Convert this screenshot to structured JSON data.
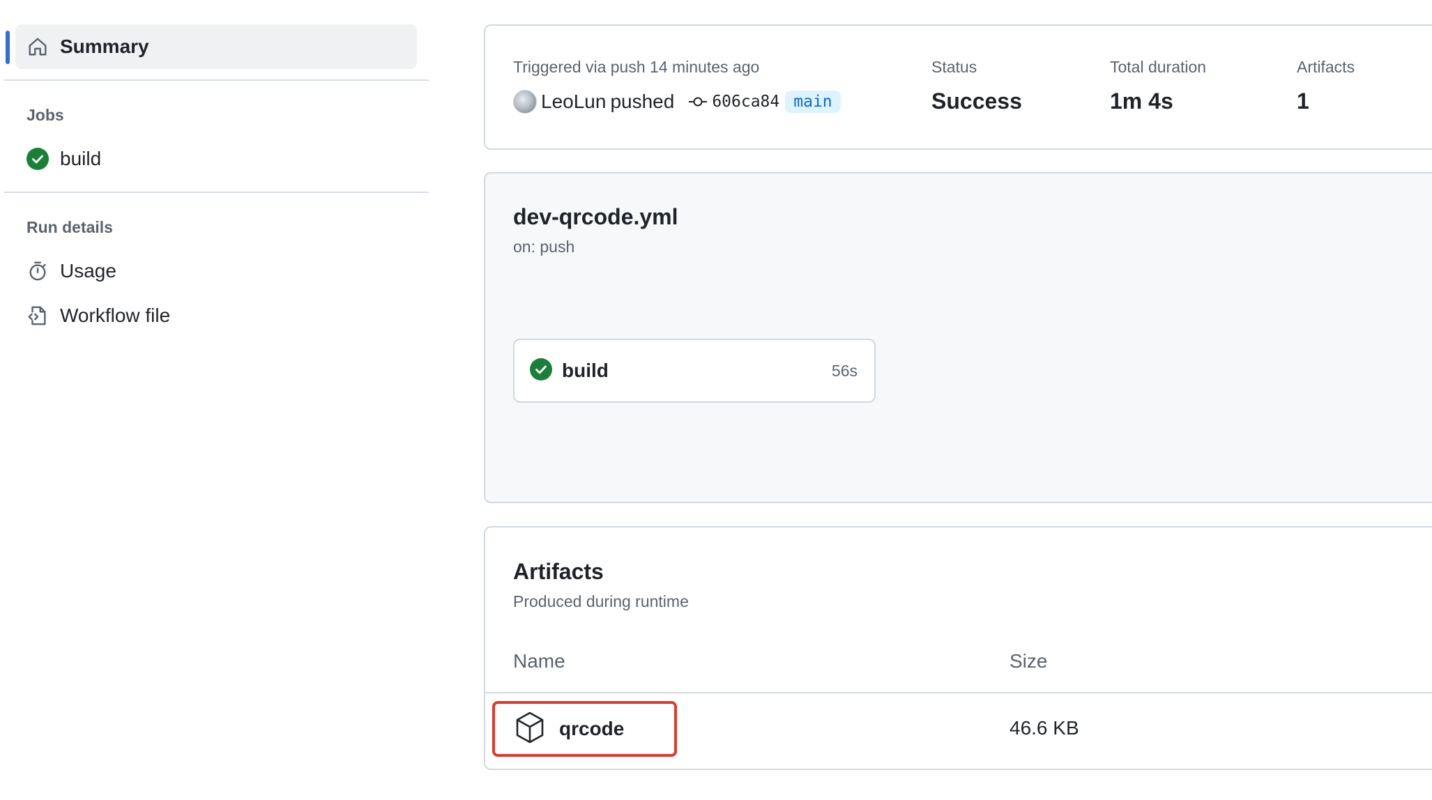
{
  "sidebar": {
    "summary_label": "Summary",
    "jobs_heading": "Jobs",
    "jobs": [
      {
        "label": "build",
        "status": "success"
      }
    ],
    "run_details_heading": "Run details",
    "details": [
      {
        "label": "Usage",
        "icon": "stopwatch-icon"
      },
      {
        "label": "Workflow file",
        "icon": "file-code-icon"
      }
    ]
  },
  "run_header": {
    "trigger_text": "Triggered via push 14 minutes ago",
    "actor": "LeoLun",
    "action": "pushed",
    "commit_sha": "606ca84",
    "branch": "main",
    "status_label": "Status",
    "status_value": "Success",
    "duration_label": "Total duration",
    "duration_value": "1m 4s",
    "artifacts_label": "Artifacts",
    "artifacts_value": "1"
  },
  "workflow": {
    "file_name": "dev-qrcode.yml",
    "trigger": "on: push",
    "jobs": [
      {
        "name": "build",
        "duration": "56s",
        "status": "success"
      }
    ]
  },
  "artifacts": {
    "title": "Artifacts",
    "subtitle": "Produced during runtime",
    "columns": {
      "name": "Name",
      "size": "Size"
    },
    "rows": [
      {
        "name": "qrcode",
        "size": "46.6 KB"
      }
    ]
  },
  "colors": {
    "accent": "#2f6ed8",
    "success": "#1a7f37",
    "highlight": "#e0392b",
    "branch_bg": "#ddf4ff",
    "branch_fg": "#0969da"
  }
}
